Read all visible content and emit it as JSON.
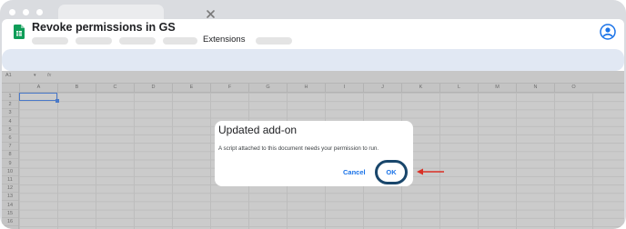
{
  "window": {
    "title": "Revoke permissions in GS",
    "menu_visible_item": "Extensions"
  },
  "sheet": {
    "name_box": "A1",
    "fx_label": "fx",
    "columns": [
      "A",
      "B",
      "C",
      "D",
      "E",
      "F",
      "G",
      "H",
      "I",
      "J",
      "K",
      "L",
      "M",
      "N",
      "O"
    ],
    "rows": [
      "1",
      "2",
      "3",
      "4",
      "5",
      "6",
      "7",
      "8",
      "9",
      "10",
      "11",
      "12",
      "13",
      "14",
      "15",
      "16"
    ]
  },
  "dialog": {
    "title": "Updated add-on",
    "message": "A script attached to this document needs your permission to run.",
    "cancel_label": "Cancel",
    "ok_label": "OK"
  },
  "colors": {
    "accent": "#1a73e8",
    "highlight_ring": "#19466b",
    "annotation_arrow": "#d93025",
    "sheets_green": "#0f9d58"
  }
}
